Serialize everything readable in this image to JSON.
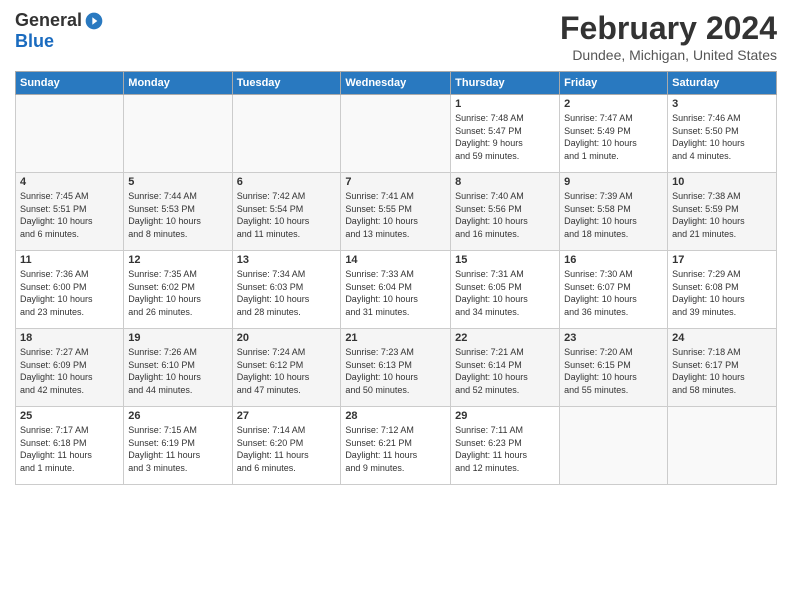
{
  "logo": {
    "general": "General",
    "blue": "Blue"
  },
  "title": "February 2024",
  "location": "Dundee, Michigan, United States",
  "headers": [
    "Sunday",
    "Monday",
    "Tuesday",
    "Wednesday",
    "Thursday",
    "Friday",
    "Saturday"
  ],
  "weeks": [
    [
      {
        "day": "",
        "info": ""
      },
      {
        "day": "",
        "info": ""
      },
      {
        "day": "",
        "info": ""
      },
      {
        "day": "",
        "info": ""
      },
      {
        "day": "1",
        "info": "Sunrise: 7:48 AM\nSunset: 5:47 PM\nDaylight: 9 hours\nand 59 minutes."
      },
      {
        "day": "2",
        "info": "Sunrise: 7:47 AM\nSunset: 5:49 PM\nDaylight: 10 hours\nand 1 minute."
      },
      {
        "day": "3",
        "info": "Sunrise: 7:46 AM\nSunset: 5:50 PM\nDaylight: 10 hours\nand 4 minutes."
      }
    ],
    [
      {
        "day": "4",
        "info": "Sunrise: 7:45 AM\nSunset: 5:51 PM\nDaylight: 10 hours\nand 6 minutes."
      },
      {
        "day": "5",
        "info": "Sunrise: 7:44 AM\nSunset: 5:53 PM\nDaylight: 10 hours\nand 8 minutes."
      },
      {
        "day": "6",
        "info": "Sunrise: 7:42 AM\nSunset: 5:54 PM\nDaylight: 10 hours\nand 11 minutes."
      },
      {
        "day": "7",
        "info": "Sunrise: 7:41 AM\nSunset: 5:55 PM\nDaylight: 10 hours\nand 13 minutes."
      },
      {
        "day": "8",
        "info": "Sunrise: 7:40 AM\nSunset: 5:56 PM\nDaylight: 10 hours\nand 16 minutes."
      },
      {
        "day": "9",
        "info": "Sunrise: 7:39 AM\nSunset: 5:58 PM\nDaylight: 10 hours\nand 18 minutes."
      },
      {
        "day": "10",
        "info": "Sunrise: 7:38 AM\nSunset: 5:59 PM\nDaylight: 10 hours\nand 21 minutes."
      }
    ],
    [
      {
        "day": "11",
        "info": "Sunrise: 7:36 AM\nSunset: 6:00 PM\nDaylight: 10 hours\nand 23 minutes."
      },
      {
        "day": "12",
        "info": "Sunrise: 7:35 AM\nSunset: 6:02 PM\nDaylight: 10 hours\nand 26 minutes."
      },
      {
        "day": "13",
        "info": "Sunrise: 7:34 AM\nSunset: 6:03 PM\nDaylight: 10 hours\nand 28 minutes."
      },
      {
        "day": "14",
        "info": "Sunrise: 7:33 AM\nSunset: 6:04 PM\nDaylight: 10 hours\nand 31 minutes."
      },
      {
        "day": "15",
        "info": "Sunrise: 7:31 AM\nSunset: 6:05 PM\nDaylight: 10 hours\nand 34 minutes."
      },
      {
        "day": "16",
        "info": "Sunrise: 7:30 AM\nSunset: 6:07 PM\nDaylight: 10 hours\nand 36 minutes."
      },
      {
        "day": "17",
        "info": "Sunrise: 7:29 AM\nSunset: 6:08 PM\nDaylight: 10 hours\nand 39 minutes."
      }
    ],
    [
      {
        "day": "18",
        "info": "Sunrise: 7:27 AM\nSunset: 6:09 PM\nDaylight: 10 hours\nand 42 minutes."
      },
      {
        "day": "19",
        "info": "Sunrise: 7:26 AM\nSunset: 6:10 PM\nDaylight: 10 hours\nand 44 minutes."
      },
      {
        "day": "20",
        "info": "Sunrise: 7:24 AM\nSunset: 6:12 PM\nDaylight: 10 hours\nand 47 minutes."
      },
      {
        "day": "21",
        "info": "Sunrise: 7:23 AM\nSunset: 6:13 PM\nDaylight: 10 hours\nand 50 minutes."
      },
      {
        "day": "22",
        "info": "Sunrise: 7:21 AM\nSunset: 6:14 PM\nDaylight: 10 hours\nand 52 minutes."
      },
      {
        "day": "23",
        "info": "Sunrise: 7:20 AM\nSunset: 6:15 PM\nDaylight: 10 hours\nand 55 minutes."
      },
      {
        "day": "24",
        "info": "Sunrise: 7:18 AM\nSunset: 6:17 PM\nDaylight: 10 hours\nand 58 minutes."
      }
    ],
    [
      {
        "day": "25",
        "info": "Sunrise: 7:17 AM\nSunset: 6:18 PM\nDaylight: 11 hours\nand 1 minute."
      },
      {
        "day": "26",
        "info": "Sunrise: 7:15 AM\nSunset: 6:19 PM\nDaylight: 11 hours\nand 3 minutes."
      },
      {
        "day": "27",
        "info": "Sunrise: 7:14 AM\nSunset: 6:20 PM\nDaylight: 11 hours\nand 6 minutes."
      },
      {
        "day": "28",
        "info": "Sunrise: 7:12 AM\nSunset: 6:21 PM\nDaylight: 11 hours\nand 9 minutes."
      },
      {
        "day": "29",
        "info": "Sunrise: 7:11 AM\nSunset: 6:23 PM\nDaylight: 11 hours\nand 12 minutes."
      },
      {
        "day": "",
        "info": ""
      },
      {
        "day": "",
        "info": ""
      }
    ]
  ]
}
